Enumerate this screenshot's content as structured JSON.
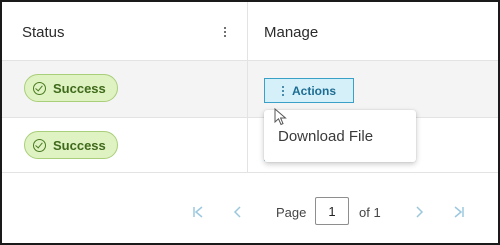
{
  "table": {
    "headers": {
      "status": "Status",
      "manage": "Manage"
    },
    "rows": [
      {
        "status": "Success",
        "action_label": "Actions"
      },
      {
        "status": "Success"
      }
    ]
  },
  "dropdown": {
    "items": [
      {
        "label": "Download File"
      }
    ]
  },
  "pagination": {
    "page_label": "Page",
    "current_page": "1",
    "of_label": "of 1"
  },
  "colors": {
    "badge_bg": "#dff2c2",
    "badge_text": "#3f6a1b",
    "action_bg": "#d6f0fa",
    "action_border": "#3aa0c8",
    "pager_icon": "#9cc8de"
  },
  "icons": {
    "badge": "check-circle-icon",
    "header_menu": "kebab-icon",
    "action_menu": "kebab-icon",
    "first_page": "first-page-icon",
    "prev_page": "prev-page-icon",
    "next_page": "next-page-icon",
    "last_page": "last-page-icon",
    "pointer": "cursor-icon"
  }
}
